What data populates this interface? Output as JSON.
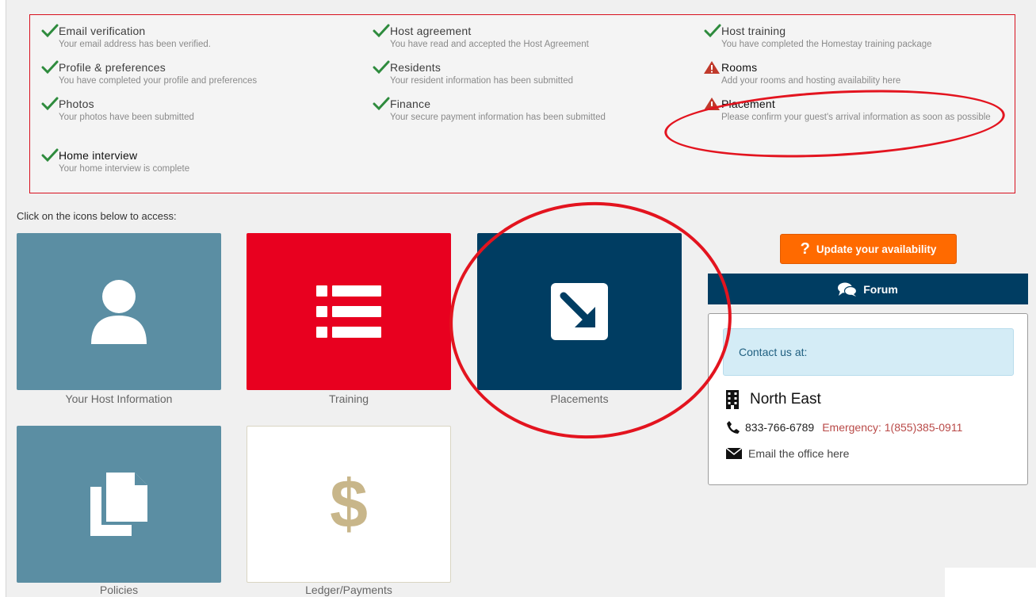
{
  "status_items": [
    {
      "title": "Email verification",
      "desc": "Your email address has been verified.",
      "state": "done"
    },
    {
      "title": "Host agreement",
      "desc": "You have read and accepted the Host Agreement",
      "state": "done"
    },
    {
      "title": "Host training",
      "desc": "You have completed the Homestay training package",
      "state": "done"
    },
    {
      "title": "Profile & preferences",
      "desc": "You have completed your profile and preferences",
      "state": "done"
    },
    {
      "title": "Residents",
      "desc": "Your resident information has been submitted",
      "state": "done"
    },
    {
      "title": "Rooms",
      "desc": "Add your rooms and hosting availability here",
      "state": "warning"
    },
    {
      "title": "Photos",
      "desc": "Your photos have been submitted",
      "state": "done"
    },
    {
      "title": "Finance",
      "desc": "Your secure payment information has been submitted",
      "state": "done"
    },
    {
      "title": "Placement",
      "desc": "Please confirm your guest's arrival information as soon as possible",
      "state": "warning"
    },
    {
      "title": "Home interview",
      "desc": "Your home interview is complete",
      "state": "done"
    }
  ],
  "prompt": "Click on the icons below to access:",
  "tiles": {
    "host": {
      "label": "Your Host Information",
      "icon": "user-icon"
    },
    "training": {
      "label": "Training",
      "icon": "list-icon"
    },
    "placements": {
      "label": "Placements",
      "icon": "arrow-down-right-icon"
    },
    "policies": {
      "label": "Policies",
      "icon": "copy-icon"
    },
    "ledger": {
      "label": "Ledger/Payments",
      "icon": "dollar-icon"
    }
  },
  "availability_button": {
    "icon": "question-icon",
    "glyph": "?",
    "label": "Update your availability"
  },
  "forum": {
    "icon": "comments-icon",
    "label": "Forum"
  },
  "contact": {
    "heading": "Contact us at:",
    "region_icon": "building-icon",
    "region": "North East",
    "phone_icon": "phone-icon",
    "phone": "833-766-6789",
    "emergency": "Emergency: 1(855)385-0911",
    "email_icon": "envelope-icon",
    "email_label": "Email the office here"
  },
  "colors": {
    "check": "#2e8b3d",
    "warning": "#c0392b",
    "annotation_circle": "#e3141f",
    "host_tile": "#5b8ea3",
    "training_tile": "#e8001f",
    "placements_tile": "#003d62",
    "availability_btn": "#ff6a00",
    "ledger_icon": "#c8b68a"
  }
}
